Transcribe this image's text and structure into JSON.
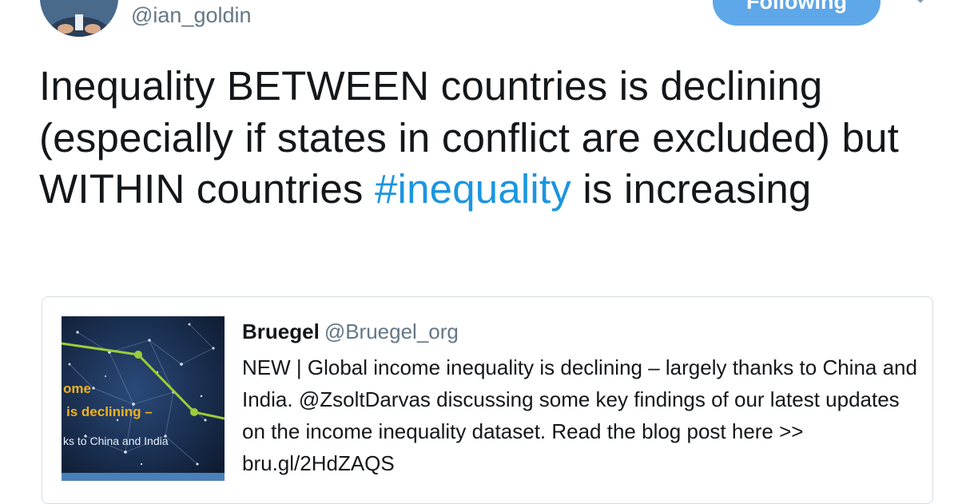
{
  "author": {
    "handle": "@ian_goldin"
  },
  "follow_button": {
    "label": "Following"
  },
  "tweet": {
    "text_before": "Inequality BETWEEN countries is declining (especially if states in conflict are excluded) but WITHIN countries ",
    "hashtag": "#inequality",
    "text_after": " is increasing"
  },
  "quoted_tweet": {
    "name": "Bruegel",
    "handle": "@Bruegel_org",
    "text": "NEW | Global income inequality is declining – largely thanks to China and India.  @ZsoltDarvas discussing some key findings of our latest updates on the income inequality dataset. Read the blog post here >> bru.gl/2HdZAQS",
    "thumbnail": {
      "line1": "ome",
      "line2": "is declining –",
      "line3": "ks to China and India"
    }
  },
  "colors": {
    "link": "#1b95e0",
    "button": "#5ea7e8",
    "secondary_text": "#657786",
    "card_border": "#d6dde3"
  }
}
